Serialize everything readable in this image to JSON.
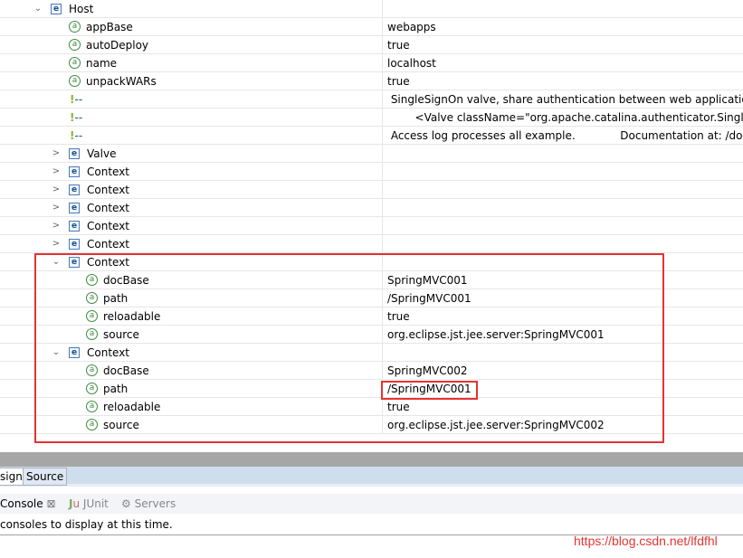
{
  "tree": {
    "rows": [
      {
        "type": "element",
        "name": "Host",
        "level": 0,
        "expanded": true
      },
      {
        "type": "attribute",
        "name": "appBase",
        "value": "webapps",
        "level": 1
      },
      {
        "type": "attribute",
        "name": "autoDeploy",
        "value": "true",
        "level": 1
      },
      {
        "type": "attribute",
        "name": "name",
        "value": "localhost",
        "level": 1
      },
      {
        "type": "attribute",
        "name": "unpackWARs",
        "value": "true",
        "level": 1
      },
      {
        "type": "comment",
        "name": "--",
        "value": " SingleSignOn valve, share authentication between web applications",
        "level": 1
      },
      {
        "type": "comment",
        "name": "--",
        "value": "        <Valve className=\"org.apache.catalina.authenticator.SingleSi",
        "level": 1
      },
      {
        "type": "comment",
        "name": "--",
        "value": " Access log processes all example.             Documentation at: /docs",
        "level": 1
      },
      {
        "type": "element",
        "name": "Valve",
        "level": 1,
        "expanded": false
      },
      {
        "type": "element",
        "name": "Context",
        "level": 1,
        "expanded": false
      },
      {
        "type": "element",
        "name": "Context",
        "level": 1,
        "expanded": false
      },
      {
        "type": "element",
        "name": "Context",
        "level": 1,
        "expanded": false
      },
      {
        "type": "element",
        "name": "Context",
        "level": 1,
        "expanded": false
      },
      {
        "type": "element",
        "name": "Context",
        "level": 1,
        "expanded": false
      },
      {
        "type": "element",
        "name": "Context",
        "level": 1,
        "expanded": true
      },
      {
        "type": "attribute",
        "name": "docBase",
        "value": "SpringMVC001",
        "level": 2
      },
      {
        "type": "attribute",
        "name": "path",
        "value": "/SpringMVC001",
        "level": 2
      },
      {
        "type": "attribute",
        "name": "reloadable",
        "value": "true",
        "level": 2
      },
      {
        "type": "attribute",
        "name": "source",
        "value": "org.eclipse.jst.jee.server:SpringMVC001",
        "level": 2
      },
      {
        "type": "element",
        "name": "Context",
        "level": 1,
        "expanded": true
      },
      {
        "type": "attribute",
        "name": "docBase",
        "value": "SpringMVC002",
        "level": 2
      },
      {
        "type": "attribute",
        "name": "path",
        "value": "/SpringMVC001",
        "level": 2,
        "highlighted": true
      },
      {
        "type": "attribute",
        "name": "reloadable",
        "value": "true",
        "level": 2
      },
      {
        "type": "attribute",
        "name": "source",
        "value": "org.eclipse.jst.jee.server:SpringMVC002",
        "level": 2
      }
    ]
  },
  "editor_tabs": [
    "sign",
    "Source"
  ],
  "panel_tabs": {
    "console": "Console",
    "junit": "JUnit",
    "servers": "Servers"
  },
  "console_text": "consoles to display at this time.",
  "watermark": "https://blog.csdn.net/lfdfhl",
  "colors": {
    "highlight": "#e53333"
  }
}
